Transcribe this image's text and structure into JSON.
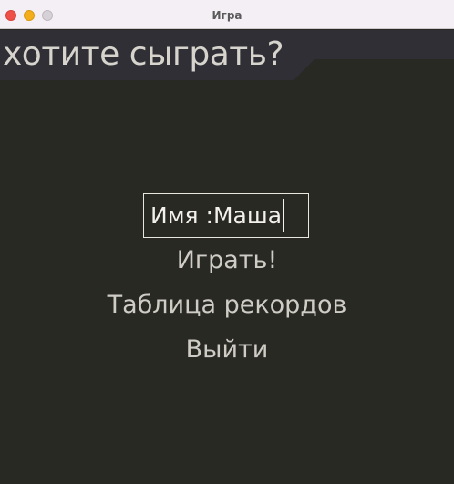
{
  "window": {
    "title": "Игра",
    "controls": [
      "close",
      "minimize",
      "maximize"
    ]
  },
  "banner": {
    "text": "хотите сыграть?"
  },
  "name_input": {
    "label": "Имя :",
    "value": "Маша"
  },
  "menu": {
    "play_label": "Играть!",
    "records_label": "Таблица рекордов",
    "quit_label": "Выйти"
  },
  "colors": {
    "background": "#282923",
    "banner_background": "#2f2f35",
    "text": "#cfccc5",
    "titlebar": "#f4eff4"
  }
}
